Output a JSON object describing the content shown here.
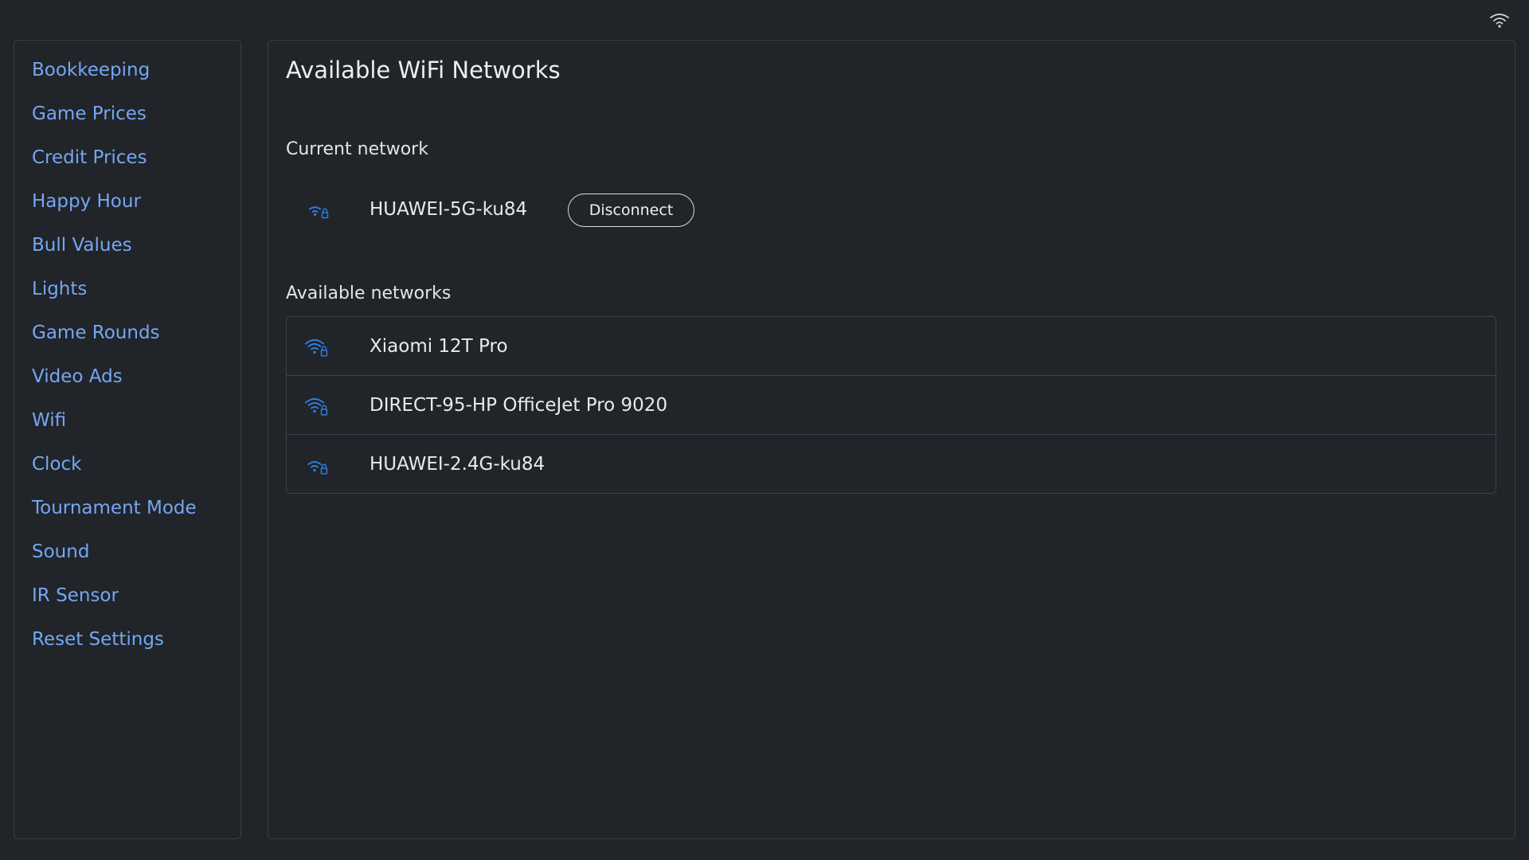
{
  "sidebar": {
    "items": [
      {
        "label": "Bookkeeping"
      },
      {
        "label": "Game Prices"
      },
      {
        "label": "Credit Prices"
      },
      {
        "label": "Happy Hour"
      },
      {
        "label": "Bull Values"
      },
      {
        "label": "Lights"
      },
      {
        "label": "Game Rounds"
      },
      {
        "label": "Video Ads"
      },
      {
        "label": "Wifi"
      },
      {
        "label": "Clock"
      },
      {
        "label": "Tournament Mode"
      },
      {
        "label": "Sound"
      },
      {
        "label": "IR Sensor"
      },
      {
        "label": "Reset Settings"
      }
    ]
  },
  "main": {
    "title": "Available WiFi Networks",
    "current": {
      "heading": "Current network",
      "name": "HUAWEI-5G-ku84",
      "icon": "wifi-lock-weak-icon",
      "disconnect_label": "Disconnect"
    },
    "available": {
      "heading": "Available networks",
      "networks": [
        {
          "name": "Xiaomi 12T Pro",
          "icon": "wifi-lock-strong-icon"
        },
        {
          "name": "DIRECT-95-HP OfficeJet Pro 9020",
          "icon": "wifi-lock-strong-icon"
        },
        {
          "name": "HUAWEI-2.4G-ku84",
          "icon": "wifi-lock-weak-icon"
        }
      ]
    }
  },
  "colors": {
    "background": "#212429",
    "link": "#74a7f2",
    "icon_blue": "#2f7de1",
    "border": "#3a3e45"
  }
}
